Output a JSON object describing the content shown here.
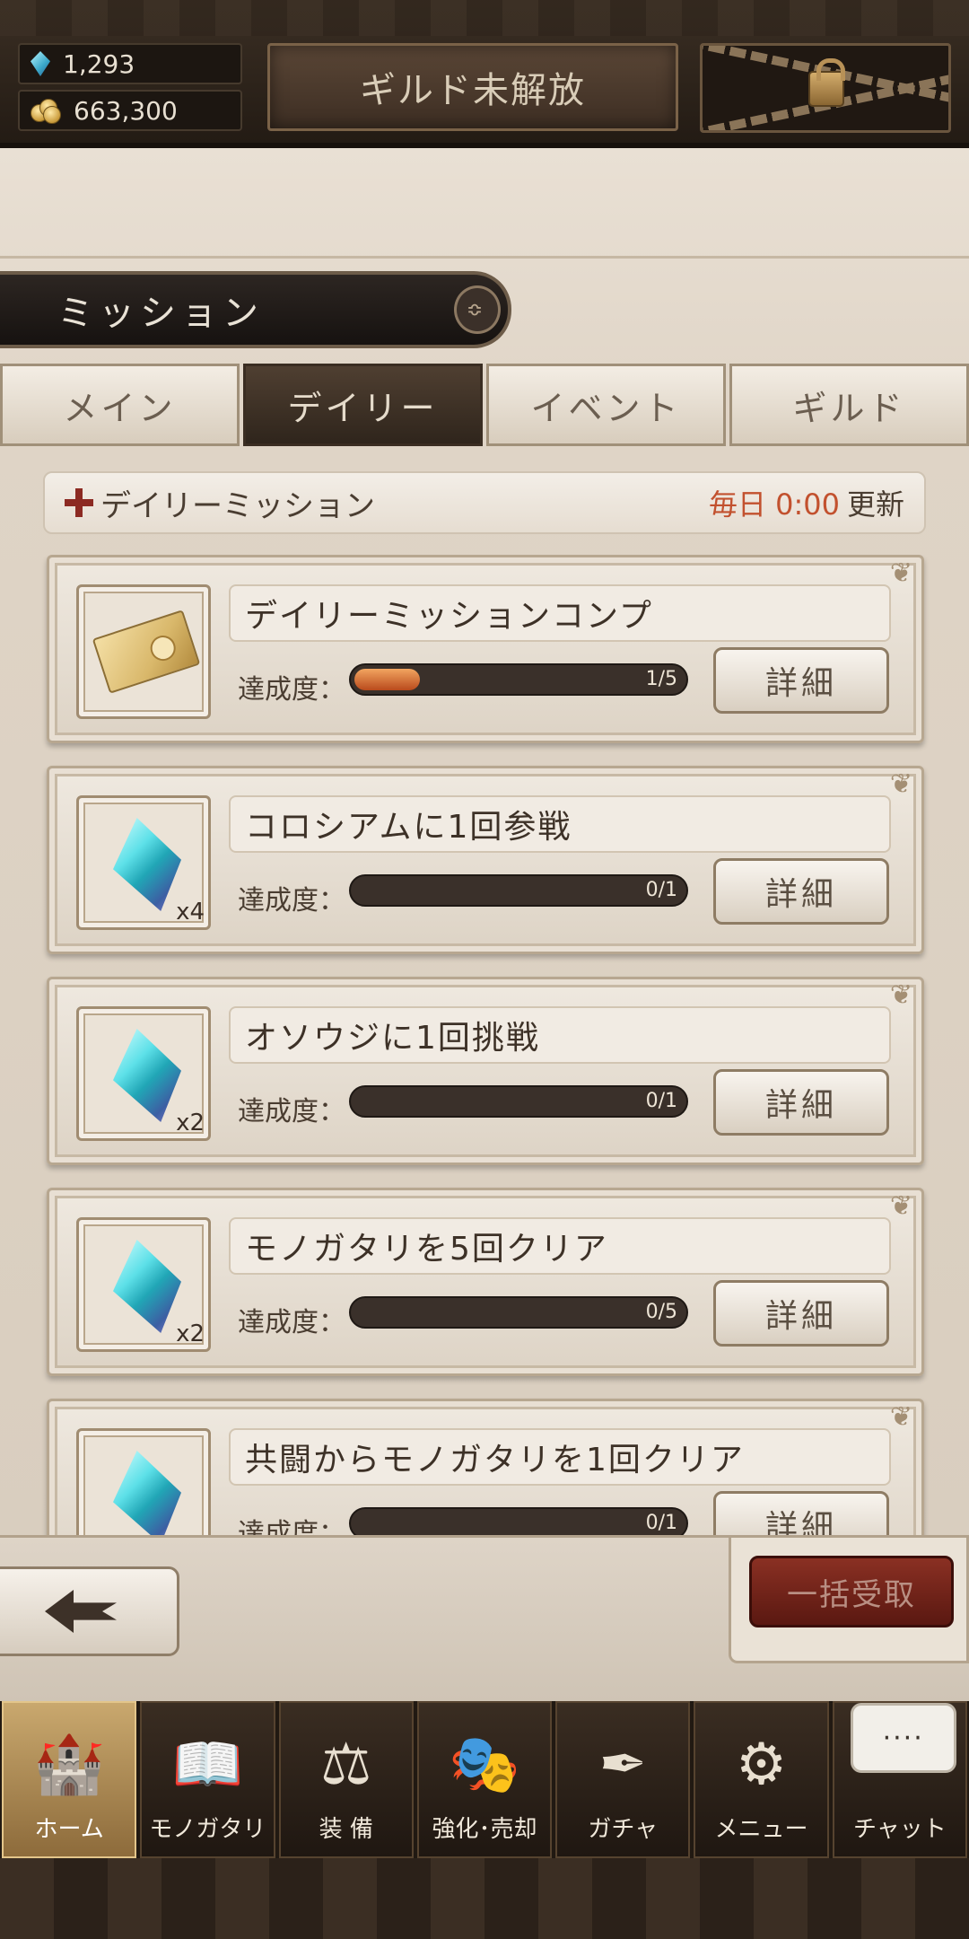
{
  "currency": {
    "gems": "1,293",
    "gold": "663,300"
  },
  "guild": {
    "label": "ギルド未解放"
  },
  "section": {
    "title": "ミッション"
  },
  "tabs": [
    {
      "label": "メイン",
      "active": false
    },
    {
      "label": "デイリー",
      "active": true
    },
    {
      "label": "イベント",
      "active": false
    },
    {
      "label": "ギルド",
      "active": false
    }
  ],
  "daily": {
    "title": "デイリーミッション",
    "reset_time": "毎日 0:00",
    "reset_suffix": "更新"
  },
  "progress_label": "達成度：",
  "detail_label": "詳細",
  "missions": [
    {
      "name": "デイリーミッションコンプ",
      "reward": "ticket-icon",
      "qty": "",
      "progress_text": "1/5",
      "progress": 0.2
    },
    {
      "name": "コロシアムに1回参戦",
      "reward": "crystal-icon",
      "qty": "x4",
      "progress_text": "0/1",
      "progress": 0
    },
    {
      "name": "オソウジに1回挑戦",
      "reward": "crystal-icon",
      "qty": "x2",
      "progress_text": "0/1",
      "progress": 0
    },
    {
      "name": "モノガタリを5回クリア",
      "reward": "crystal-icon",
      "qty": "x2",
      "progress_text": "0/5",
      "progress": 0
    },
    {
      "name": "共闘からモノガタリを1回クリア",
      "reward": "crystal-icon",
      "qty": "",
      "progress_text": "0/1",
      "progress": 0
    }
  ],
  "actions": {
    "claim_all": "一括受取"
  },
  "nav": [
    {
      "label": "ホーム",
      "icon": "castle-icon",
      "active": true
    },
    {
      "label": "モノガタリ",
      "icon": "book-icon",
      "active": false
    },
    {
      "label": "装 備",
      "icon": "equipment-icon",
      "active": false
    },
    {
      "label": "強化･売却",
      "icon": "mask-icon",
      "active": false
    },
    {
      "label": "ガチャ",
      "icon": "quill-icon",
      "active": false
    },
    {
      "label": "メニュー",
      "icon": "gears-icon",
      "active": false
    },
    {
      "label": "チャット",
      "icon": "chat-icon",
      "active": false,
      "bubble": "····"
    }
  ],
  "colors": {
    "accent_red": "#c2512e",
    "dark_brown": "#2f251c",
    "parchment": "#e9e0d4",
    "progress_fill": "#b94a1c"
  }
}
